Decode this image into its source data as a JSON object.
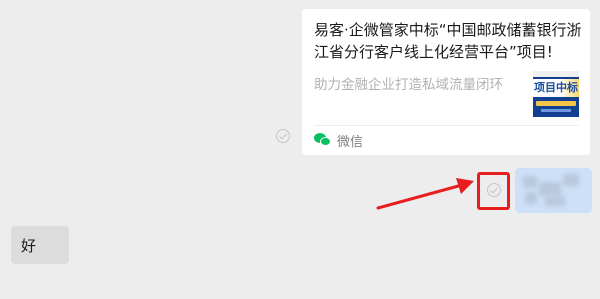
{
  "chat": {
    "shared_card": {
      "title": "易客·企微管家中标“中国邮政储蓄银行浙江省分行客户线上化经营平台”项目!",
      "description": "助力金融企业打造私域流量闭环",
      "thumbnail_text": "项目中标",
      "source_label": "微信",
      "source_icon": "wechat-icon"
    },
    "incoming_message": {
      "text": "好"
    },
    "annotation": {
      "highlight_color": "#e81d1d",
      "arrow_color": "#e81d1d"
    }
  }
}
